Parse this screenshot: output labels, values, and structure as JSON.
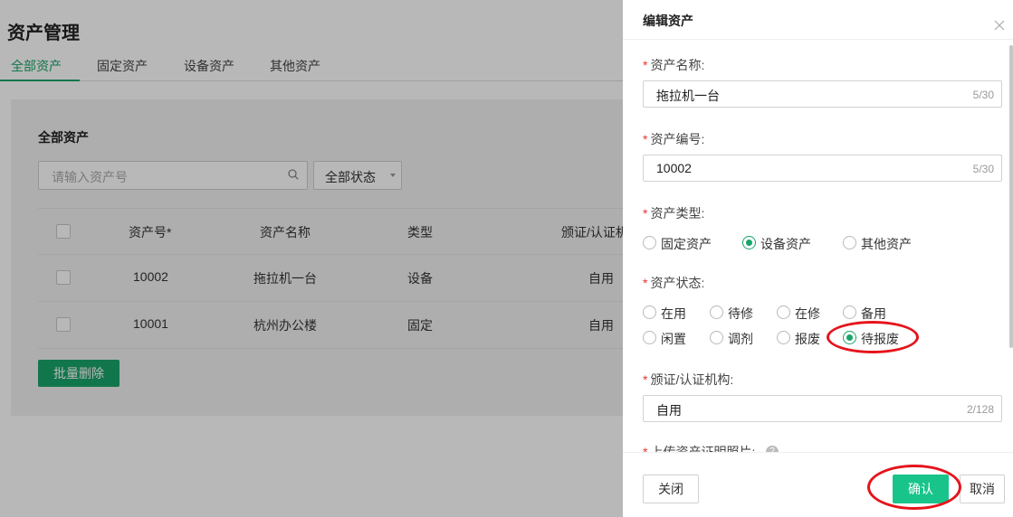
{
  "page": {
    "title": "资产管理",
    "tabs": [
      "全部资产",
      "固定资产",
      "设备资产",
      "其他资产"
    ],
    "active_tab": "全部资产"
  },
  "list": {
    "title": "全部资产",
    "search_placeholder": "请输入资产号",
    "status_filter": "全部状态",
    "columns": [
      "资产号*",
      "资产名称",
      "类型",
      "颁证/认证机"
    ],
    "rows": [
      {
        "id": "10002",
        "name": "拖拉机一台",
        "type": "设备",
        "org": "自用"
      },
      {
        "id": "10001",
        "name": "杭州办公楼",
        "type": "固定",
        "org": "自用"
      }
    ],
    "batch_delete_label": "批量删除"
  },
  "drawer": {
    "title": "编辑资产",
    "fields": {
      "name": {
        "label": "资产名称:",
        "value": "拖拉机一台",
        "count": "5/30"
      },
      "code": {
        "label": "资产编号:",
        "value": "10002",
        "count": "5/30"
      },
      "type": {
        "label": "资产类型:",
        "options": [
          "固定资产",
          "设备资产",
          "其他资产"
        ],
        "selected": "设备资产"
      },
      "status": {
        "label": "资产状态:",
        "options": [
          "在用",
          "待修",
          "在修",
          "备用",
          "闲置",
          "调剂",
          "报废",
          "待报废"
        ],
        "selected": "待报废"
      },
      "org": {
        "label": "颁证/认证机构:",
        "value": "自用",
        "count": "2/128"
      },
      "photo": {
        "label": "上传资产证明照片:"
      }
    },
    "buttons": {
      "close": "关闭",
      "confirm": "确认",
      "cancel": "取消"
    }
  },
  "colors": {
    "accent": "#19a46a",
    "confirm": "#19c48a",
    "required": "#e33333",
    "annotation": "#e5141b"
  }
}
